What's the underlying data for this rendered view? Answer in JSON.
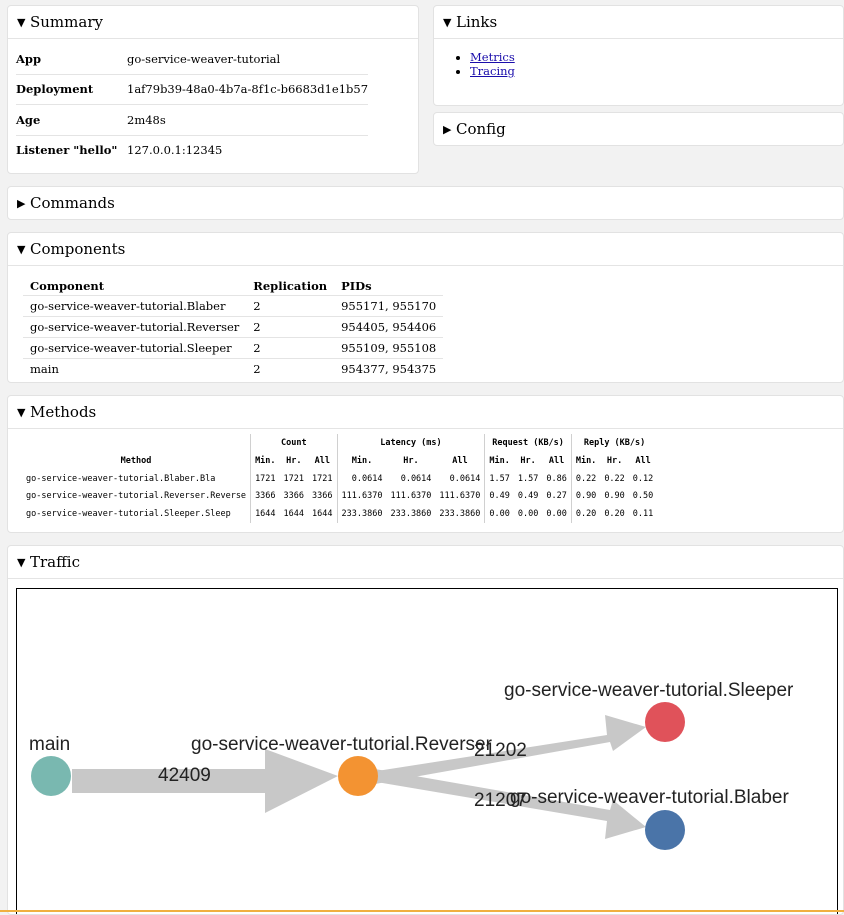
{
  "summary": {
    "title": "Summary",
    "rows": [
      {
        "key": "App",
        "value": "go-service-weaver-tutorial"
      },
      {
        "key": "Deployment",
        "value": "1af79b39-48a0-4b7a-8f1c-b6683d1e1b57"
      },
      {
        "key": "Age",
        "value": "2m48s"
      },
      {
        "key": "Listener \"hello\"",
        "value": "127.0.0.1:12345"
      }
    ]
  },
  "links": {
    "title": "Links",
    "items": [
      "Metrics",
      "Tracing"
    ]
  },
  "config": {
    "title": "Config"
  },
  "commands": {
    "title": "Commands"
  },
  "components": {
    "title": "Components",
    "headers": [
      "Component",
      "Replication",
      "PIDs"
    ],
    "rows": [
      [
        "go-service-weaver-tutorial.Blaber",
        "2",
        "955171, 955170"
      ],
      [
        "go-service-weaver-tutorial.Reverser",
        "2",
        "954405, 954406"
      ],
      [
        "go-service-weaver-tutorial.Sleeper",
        "2",
        "955109, 955108"
      ],
      [
        "main",
        "2",
        "954377, 954375"
      ]
    ]
  },
  "methods": {
    "title": "Methods",
    "groups": [
      "Count",
      "Latency (ms)",
      "Request (KB/s)",
      "Reply (KB/s)"
    ],
    "method_header": "Method",
    "sub": [
      "Min.",
      "Hr.",
      "All"
    ],
    "rows": [
      [
        "go-service-weaver-tutorial.Blaber.Bla",
        "1721",
        "1721",
        "1721",
        "0.0614",
        "0.0614",
        "0.0614",
        "1.57",
        "1.57",
        "0.86",
        "0.22",
        "0.22",
        "0.12"
      ],
      [
        "go-service-weaver-tutorial.Reverser.Reverse",
        "3366",
        "3366",
        "3366",
        "111.6370",
        "111.6370",
        "111.6370",
        "0.49",
        "0.49",
        "0.27",
        "0.90",
        "0.90",
        "0.50"
      ],
      [
        "go-service-weaver-tutorial.Sleeper.Sleep",
        "1644",
        "1644",
        "1644",
        "233.3860",
        "233.3860",
        "233.3860",
        "0.00",
        "0.00",
        "0.00",
        "0.20",
        "0.20",
        "0.11"
      ]
    ]
  },
  "traffic": {
    "title": "Traffic",
    "nodes": {
      "main": {
        "label": "main",
        "color": "#79b8b0"
      },
      "reverser": {
        "label": "go-service-weaver-tutorial.Reverser",
        "color": "#f39332"
      },
      "sleeper": {
        "label": "go-service-weaver-tutorial.Sleeper",
        "color": "#e0525a"
      },
      "blaber": {
        "label": "go-service-weaver-tutorial.Blaber",
        "color": "#4a74a8"
      }
    },
    "edges": {
      "main_reverser": "42409",
      "reverser_sleeper": "21202",
      "reverser_blaber": "21207"
    }
  }
}
